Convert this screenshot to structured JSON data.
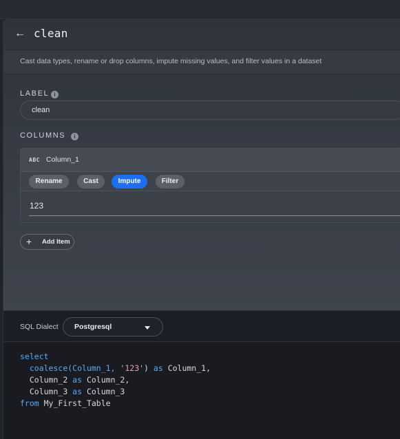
{
  "panel": {
    "title": "clean",
    "description": "Cast data types, rename or drop columns, impute missing values, and filter values in a dataset"
  },
  "label_section": {
    "heading": "LABEL",
    "value": "clean"
  },
  "columns_section": {
    "heading": "COLUMNS",
    "column": {
      "type_badge": "ABC",
      "name": "Column_1",
      "tabs": [
        "Rename",
        "Cast",
        "Impute",
        "Filter"
      ],
      "active_tab": "Impute",
      "value": "123"
    },
    "add_item_label": "Add Item"
  },
  "sql": {
    "dialect_label": "SQL Dialect",
    "dialect_value": "Postgresql",
    "code": {
      "l1_kw": "select",
      "l2_fn": "coalesce(Column_1, ",
      "l2_str": "'123'",
      "l2_mid": ") ",
      "l2_kw": "as",
      "l2_end": " Column_1,",
      "l3_a": "Column_2 ",
      "l3_kw": "as",
      "l3_b": " Column_2,",
      "l4_a": "Column_3 ",
      "l4_kw": "as",
      "l4_b": " Column_3",
      "l5_kw": "from",
      "l5_b": " My_First_Table"
    }
  },
  "colors": {
    "accent": "#1c6ff0",
    "keyword": "#5da9f0",
    "string": "#e3a7a4"
  }
}
